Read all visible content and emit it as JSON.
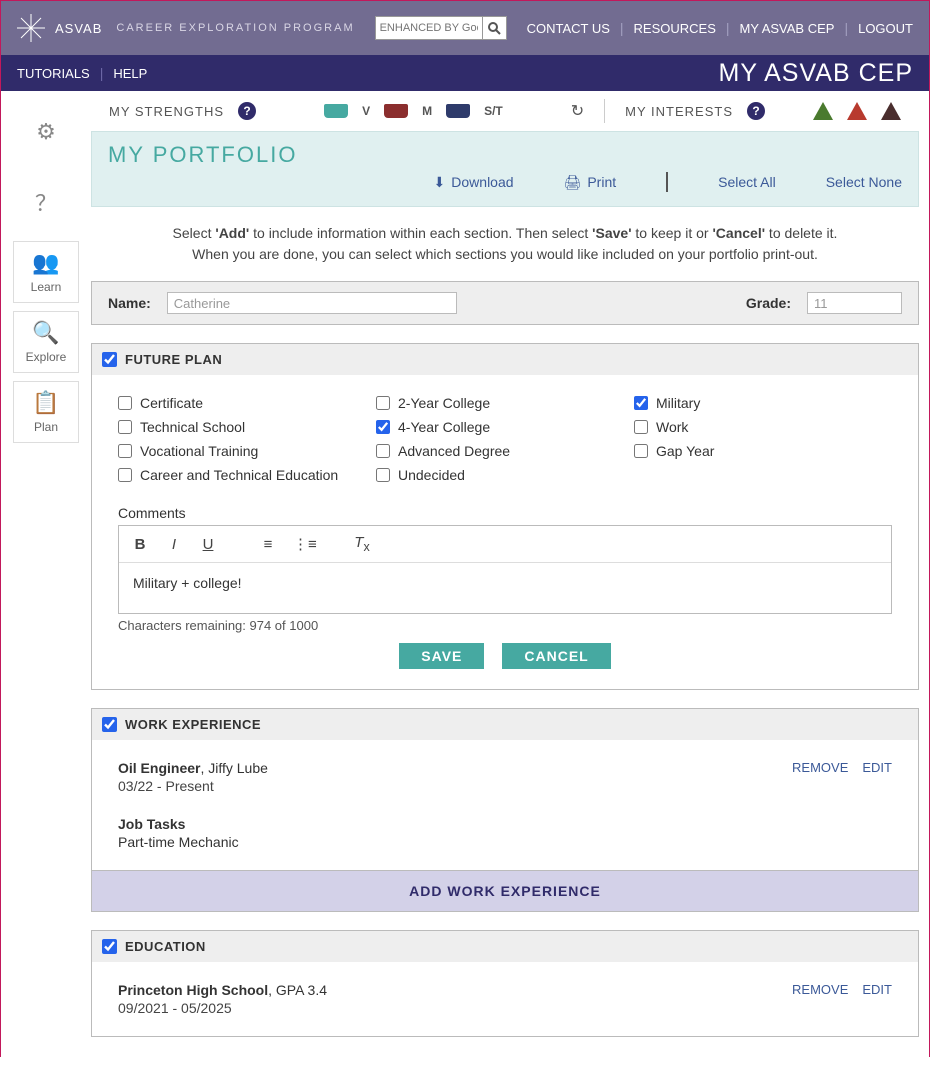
{
  "header": {
    "brand": "ASVAB",
    "brand_sub": "CAREER EXPLORATION PROGRAM",
    "search_placeholder": "ENHANCED BY Goo",
    "nav": {
      "contact": "CONTACT US",
      "resources": "RESOURCES",
      "mycep": "MY ASVAB CEP",
      "logout": "LOGOUT"
    }
  },
  "subbar": {
    "tutorials": "TUTORIALS",
    "help": "HELP",
    "page": "MY ASVAB CEP"
  },
  "leftnav": {
    "learn": "Learn",
    "explore": "Explore",
    "plan": "Plan"
  },
  "context": {
    "strengths": "MY STRENGTHS",
    "v": "V",
    "m": "M",
    "st": "S/T",
    "interests": "MY INTERESTS"
  },
  "portfolio": {
    "title": "MY PORTFOLIO",
    "download": "Download",
    "print": "Print",
    "select_all": "Select All",
    "select_none": "Select None",
    "instr_1a": "Select ",
    "instr_1b": "'Add'",
    "instr_1c": " to include information within each section. Then select ",
    "instr_1d": "'Save'",
    "instr_1e": " to keep it or ",
    "instr_1f": "'Cancel'",
    "instr_1g": " to delete it.",
    "instr_2": "When you are done, you can select which sections you would like included on your portfolio print-out.",
    "name_label": "Name:",
    "name_value": "Catherine",
    "grade_label": "Grade:",
    "grade_value": "11"
  },
  "future_plan": {
    "title": "FUTURE PLAN",
    "opts": {
      "certificate": "Certificate",
      "technical": "Technical School",
      "vocational": "Vocational Training",
      "cte": "Career and Technical Education",
      "two_year": "2-Year College",
      "four_year": "4-Year College",
      "advanced": "Advanced Degree",
      "undecided": "Undecided",
      "military": "Military",
      "work": "Work",
      "gap": "Gap Year"
    },
    "comments_label": "Comments",
    "comment_text": "Military + college!",
    "chars": "Characters remaining: 974 of 1000",
    "save": "SAVE",
    "cancel": "CANCEL"
  },
  "work": {
    "title": "WORK EXPERIENCE",
    "remove": "REMOVE",
    "edit": "EDIT",
    "job_title": "Oil Engineer",
    "company": ", Jiffy Lube",
    "dates": "03/22 - Present",
    "tasks_label": "Job Tasks",
    "tasks": "Part-time Mechanic",
    "add": "ADD WORK EXPERIENCE"
  },
  "education": {
    "title": "EDUCATION",
    "remove": "REMOVE",
    "edit": "EDIT",
    "school": "Princeton High School",
    "gpa": ", GPA 3.4",
    "dates": "09/2021 - 05/2025"
  }
}
